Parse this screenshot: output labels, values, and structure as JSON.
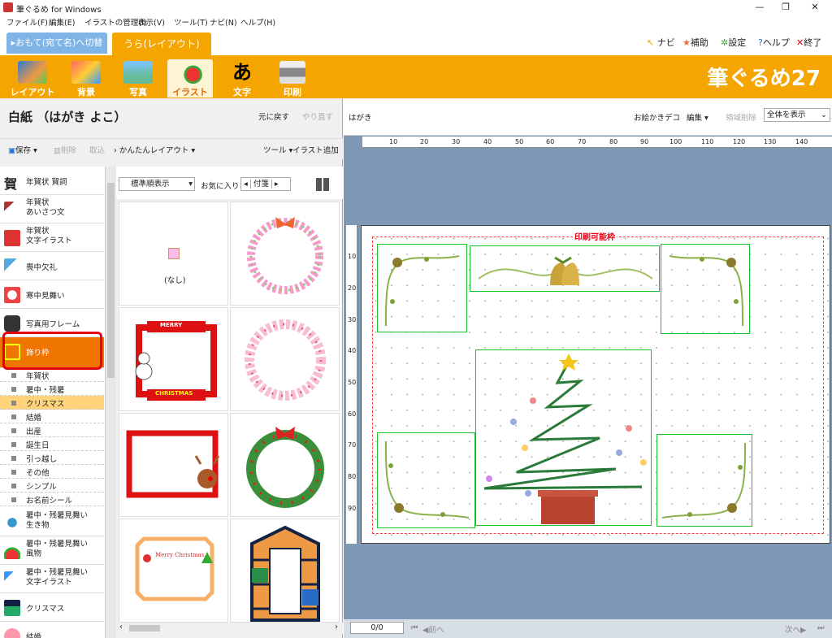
{
  "window": {
    "title": "筆ぐるめ for Windows"
  },
  "menu": [
    "ファイル(F)",
    "編集(E)",
    "イラストの管理(I)",
    "表示(V)",
    "ツール(T)",
    "ナビ(N)",
    "ヘルプ(H)"
  ],
  "mode_tabs": {
    "front": "▸おもて(宛て名)へ切替",
    "back": "うら(レイアウト)"
  },
  "top_links": {
    "navi": "ナビ",
    "assist": "補助",
    "settings": "設定",
    "help": "ヘルプ",
    "exit": "終了"
  },
  "tools": [
    {
      "label": "レイアウト",
      "icon": "layout-icon"
    },
    {
      "label": "背景",
      "icon": "background-icon"
    },
    {
      "label": "写真",
      "icon": "photo-icon"
    },
    {
      "label": "イラスト",
      "icon": "illustration-icon"
    },
    {
      "label": "文字",
      "icon": "text-icon"
    },
    {
      "label": "印刷",
      "icon": "printer-icon"
    }
  ],
  "brand": "筆ぐるめ27",
  "left": {
    "doc_title": "白紙 （はがき よこ）",
    "undo": "元に戻す",
    "redo": "やり直す",
    "save": "保存",
    "delete": "削除",
    "import": "取込",
    "easy_layout": "かんたんレイアウト",
    "tools": "ツール",
    "add_illust": "イラスト追加"
  },
  "categories": [
    {
      "label1": "年賀状 賀詞",
      "label2": ""
    },
    {
      "label1": "年賀状",
      "label2": "あいさつ文"
    },
    {
      "label1": "年賀状",
      "label2": "文字イラスト"
    },
    {
      "label1": "喪中欠礼",
      "label2": ""
    },
    {
      "label1": "寒中見舞い",
      "label2": ""
    },
    {
      "label1": "写真用フレーム",
      "label2": ""
    },
    {
      "label1": "飾り枠",
      "label2": ""
    }
  ],
  "subcategories": [
    "年賀状",
    "暑中・残暑",
    "クリスマス",
    "結婚",
    "出産",
    "誕生日",
    "引っ越し",
    "その他",
    "シンプル",
    "お名前シール"
  ],
  "categories_after": [
    {
      "label1": "暑中・残暑見舞い",
      "label2": "生き物"
    },
    {
      "label1": "暑中・残暑見舞い",
      "label2": "風物"
    },
    {
      "label1": "暑中・残暑見舞い",
      "label2": "文字イラスト"
    },
    {
      "label1": "クリスマス",
      "label2": ""
    },
    {
      "label1": "結婚",
      "label2": ""
    }
  ],
  "grid": {
    "sort": "標準順表示",
    "favorites": "お気に入り",
    "tag": "付箋",
    "none_label": "(なし)",
    "merry": "MERRY",
    "christmas": "CHRISTMAS",
    "merry_christmas": "Merry Christmas"
  },
  "right": {
    "paper": "はがき",
    "deco": "お絵かきデコ",
    "edit": "編集",
    "area_delete": "領域削除",
    "view": "全体を表示",
    "print_area": "印刷可能枠",
    "page": "0/0",
    "prev": "前へ",
    "next": "次へ"
  },
  "ruler_h": [
    "10",
    "20",
    "30",
    "40",
    "50",
    "60",
    "70",
    "80",
    "90",
    "100",
    "110",
    "120",
    "130",
    "140"
  ],
  "ruler_v": [
    "10",
    "20",
    "30",
    "40",
    "50",
    "60",
    "70",
    "80",
    "90"
  ],
  "colors": {
    "accent": "#f5a500",
    "selected": "#f07400",
    "highlight": "#e60012",
    "box": "#19c02b"
  }
}
